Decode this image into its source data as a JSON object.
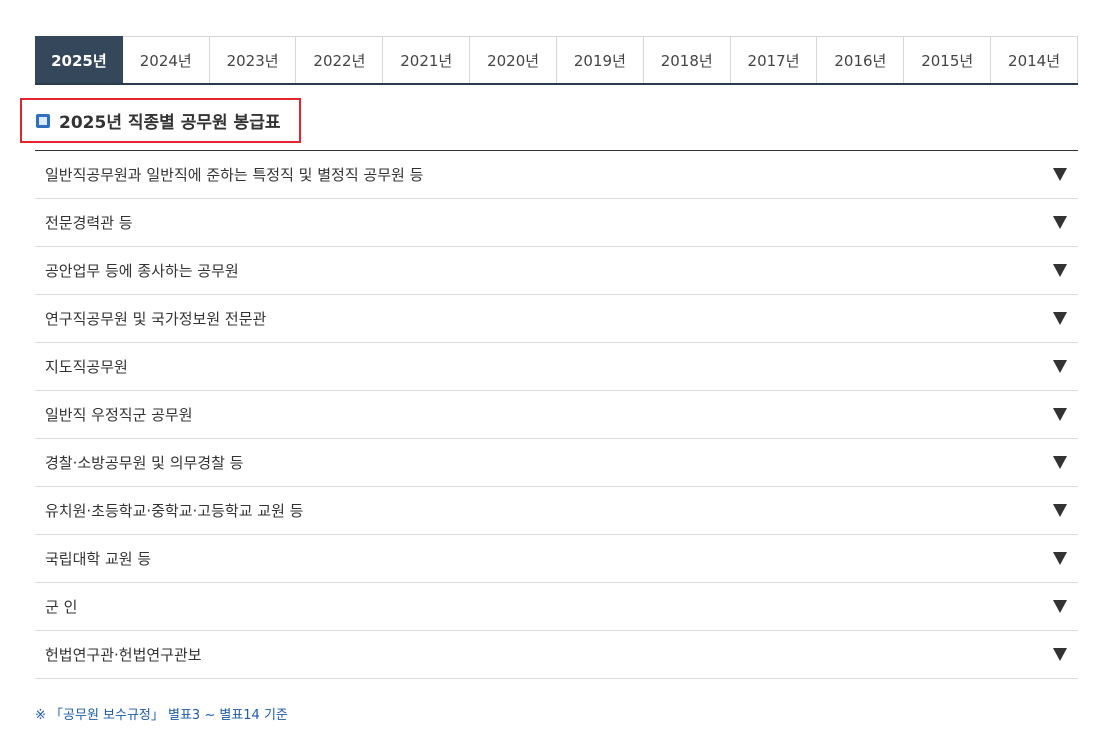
{
  "tabs": [
    {
      "label": "2025년",
      "active": true
    },
    {
      "label": "2024년"
    },
    {
      "label": "2023년"
    },
    {
      "label": "2022년"
    },
    {
      "label": "2021년"
    },
    {
      "label": "2020년"
    },
    {
      "label": "2019년"
    },
    {
      "label": "2018년"
    },
    {
      "label": "2017년"
    },
    {
      "label": "2016년"
    },
    {
      "label": "2015년"
    },
    {
      "label": "2014년"
    }
  ],
  "section": {
    "title": "2025년 직종별 공무원 봉급표",
    "icon": "square-bullet-icon",
    "highlight_color": "#e5242b"
  },
  "accordion": {
    "items": [
      {
        "label": "일반직공무원과 일반직에 준하는 특정직 및 별정직 공무원 등"
      },
      {
        "label": "전문경력관 등"
      },
      {
        "label": "공안업무 등에 종사하는 공무원"
      },
      {
        "label": "연구직공무원 및 국가정보원 전문관"
      },
      {
        "label": "지도직공무원"
      },
      {
        "label": "일반직 우정직군 공무원"
      },
      {
        "label": "경찰·소방공무원 및 의무경찰 등"
      },
      {
        "label": "유치원·초등학교·중학교·고등학교 교원 등"
      },
      {
        "label": "국립대학 교원 등"
      },
      {
        "label": "군 인"
      },
      {
        "label": "헌법연구관·헌법연구관보"
      }
    ],
    "expand_icon": "triangle-down-icon"
  },
  "footnote": "※ 「공무원 보수규정」 별표3 ~ 별표14 기준",
  "colors": {
    "active_tab_bg": "#35475b",
    "accent_blue": "#2e6fc1",
    "footnote": "#1e5ba8"
  }
}
